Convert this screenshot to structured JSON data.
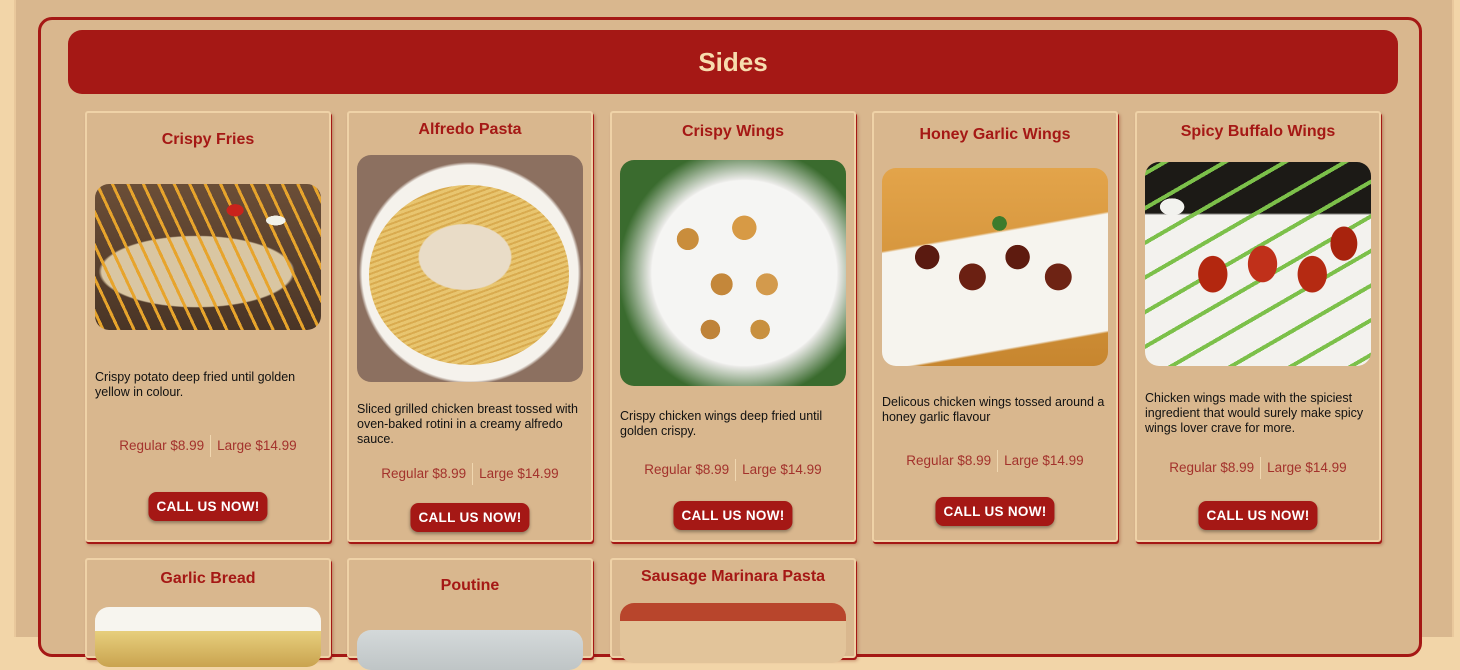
{
  "section": {
    "title": "Sides"
  },
  "items": [
    {
      "name": "Crispy Fries",
      "description": "Crispy potato deep fried until golden yellow in colour.",
      "regular": "Regular $8.99",
      "large": "Large $14.99",
      "cta": "CALL US NOW!",
      "image": "crispy-fries-photo"
    },
    {
      "name": "Alfredo Pasta",
      "description": "Sliced grilled chicken breast tossed with oven-baked rotini in a creamy alfredo sauce.",
      "regular": "Regular $8.99",
      "large": "Large $14.99",
      "cta": "CALL US NOW!",
      "image": "alfredo-pasta-photo"
    },
    {
      "name": "Crispy Wings",
      "description": "Crispy chicken wings deep fried until golden crispy.",
      "regular": "Regular $8.99",
      "large": "Large $14.99",
      "cta": "CALL US NOW!",
      "image": "crispy-wings-photo"
    },
    {
      "name": "Honey Garlic Wings",
      "description": "Delicous chicken wings tossed around a honey garlic flavour",
      "regular": "Regular $8.99",
      "large": "Large $14.99",
      "cta": "CALL US NOW!",
      "image": "honey-garlic-wings-photo"
    },
    {
      "name": "Spicy Buffalo Wings",
      "description": "Chicken wings made with the spiciest ingredient that would surely make spicy wings lover crave for more.",
      "regular": "Regular $8.99",
      "large": "Large $14.99",
      "cta": "CALL US NOW!",
      "image": "spicy-buffalo-wings-photo"
    },
    {
      "name": "Garlic Bread",
      "image": "garlic-bread-photo"
    },
    {
      "name": "Poutine",
      "image": "poutine-photo"
    },
    {
      "name": "Sausage Marinara Pasta",
      "image": "sausage-marinara-pasta-photo"
    }
  ],
  "colors": {
    "accent": "#a51815",
    "background": "#d9b78e",
    "title_text": "#f7dcae"
  }
}
